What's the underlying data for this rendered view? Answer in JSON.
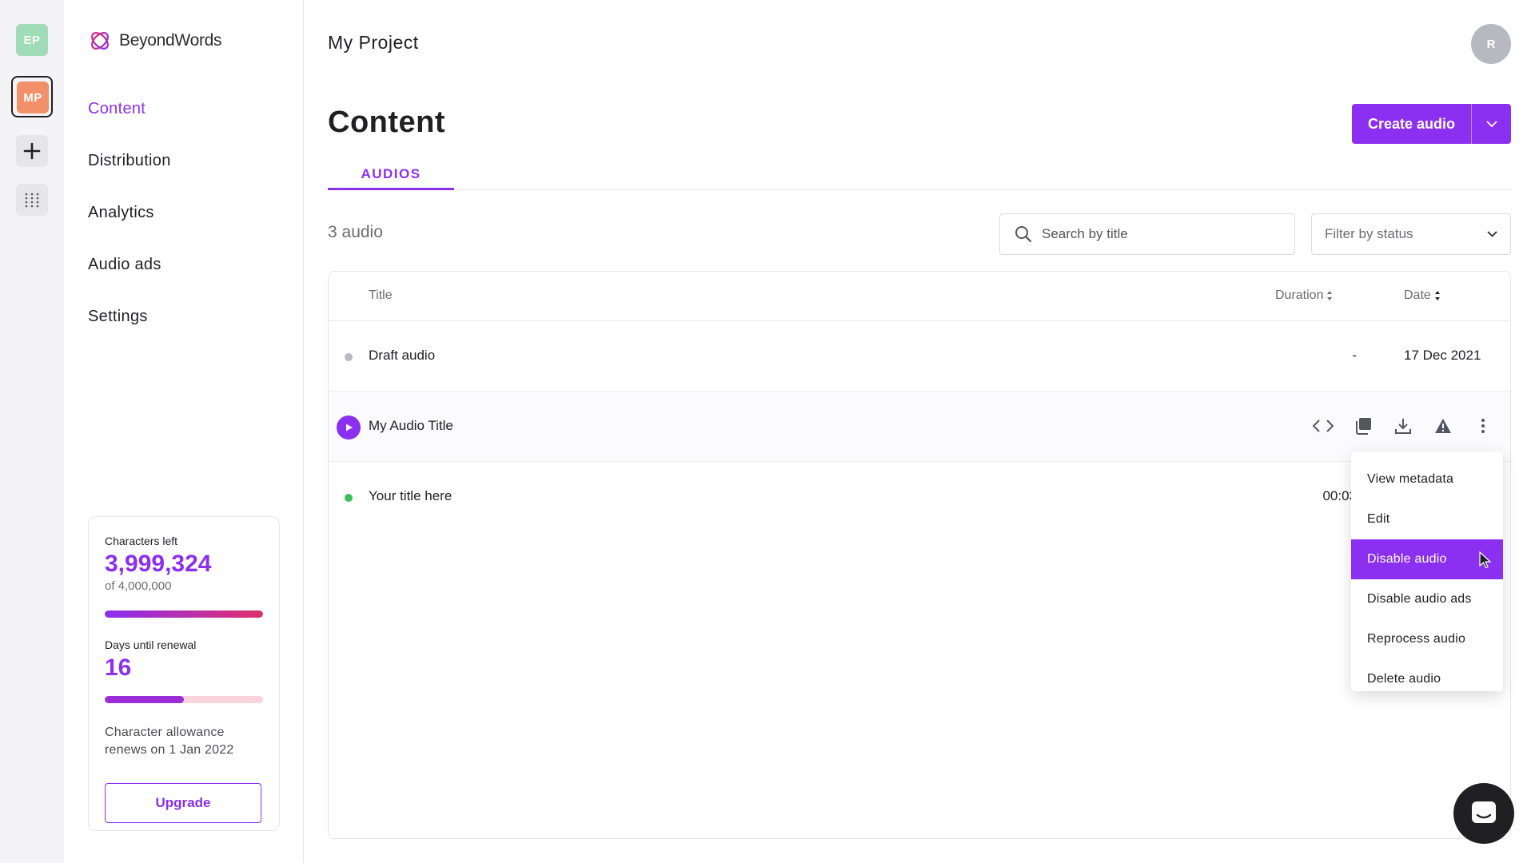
{
  "rail": {
    "projects": [
      {
        "initials": "EP",
        "color": "#9fdcb7"
      },
      {
        "initials": "MP",
        "color": "#f2906a",
        "selected": true
      }
    ],
    "icons": [
      "plus-icon",
      "apps-grid-icon"
    ]
  },
  "brand": {
    "name": "BeyondWords",
    "accent": "#8b2ff0"
  },
  "nav": {
    "items": [
      {
        "label": "Content",
        "active": true
      },
      {
        "label": "Distribution"
      },
      {
        "label": "Analytics"
      },
      {
        "label": "Audio ads"
      },
      {
        "label": "Settings"
      }
    ]
  },
  "usage": {
    "chars_label": "Characters left",
    "chars_value": "3,999,324",
    "chars_total": "of 4,000,000",
    "chars_fraction": 0.9998,
    "days_label": "Days until renewal",
    "days_value": "16",
    "days_fraction": 0.5,
    "note": "Character allowance renews on 1 Jan 2022",
    "upgrade_label": "Upgrade"
  },
  "header": {
    "project": "My Project",
    "avatar": "R"
  },
  "content": {
    "title": "Content",
    "create_label": "Create audio",
    "tab": "AUDIOS",
    "count": "3 audio",
    "search_placeholder": "Search by title",
    "filter_placeholder": "Filter by status"
  },
  "table": {
    "columns": {
      "title": "Title",
      "duration": "Duration",
      "date": "Date"
    },
    "rows": [
      {
        "title": "Draft audio",
        "duration": "-",
        "date": "17 Dec 2021",
        "status": "draft",
        "status_color": "#b8b8c0"
      },
      {
        "title": "My Audio Title",
        "duration": "",
        "date": "",
        "status": "playing",
        "hovered": true
      },
      {
        "title": "Your title here",
        "duration": "00:03",
        "date": "",
        "status": "processed",
        "status_color": "#3bbf5a"
      }
    ],
    "row_actions": [
      "embed-code-icon",
      "copy-icon",
      "download-icon",
      "warning-icon",
      "more-vertical-icon"
    ]
  },
  "context_menu": {
    "items": [
      {
        "label": "View metadata"
      },
      {
        "label": "Edit"
      },
      {
        "label": "Disable audio",
        "highlighted": true
      },
      {
        "label": "Disable audio ads"
      },
      {
        "label": "Reprocess audio"
      },
      {
        "label": "Delete audio"
      }
    ]
  }
}
